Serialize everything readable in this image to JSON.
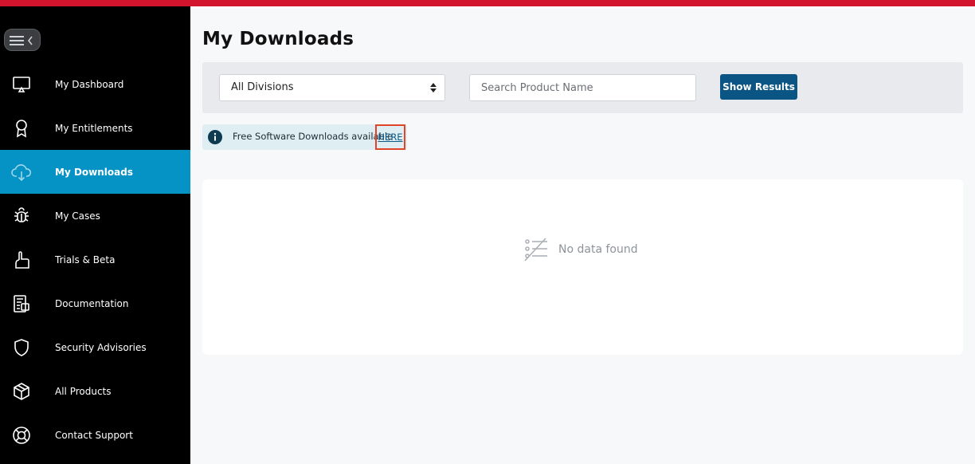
{
  "page": {
    "title": "My Downloads"
  },
  "colors": {
    "brand_red": "#d3142d",
    "active_nav": "#0592c4",
    "primary_button": "#0b5585"
  },
  "sidebar": {
    "toggle_icon": "menu-collapse-icon",
    "items": [
      {
        "label": "My Dashboard",
        "icon": "monitor-icon",
        "active": false
      },
      {
        "label": "My Entitlements",
        "icon": "award-icon",
        "active": false
      },
      {
        "label": "My Downloads",
        "icon": "cloud-download-icon",
        "active": true
      },
      {
        "label": "My Cases",
        "icon": "bug-icon",
        "active": false
      },
      {
        "label": "Trials & Beta",
        "icon": "pointer-hand-icon",
        "active": false
      },
      {
        "label": "Documentation",
        "icon": "document-icon",
        "active": false
      },
      {
        "label": "Security Advisories",
        "icon": "shield-icon",
        "active": false
      },
      {
        "label": "All Products",
        "icon": "box-icon",
        "active": false
      },
      {
        "label": "Contact Support",
        "icon": "lifebuoy-icon",
        "active": false
      }
    ]
  },
  "filters": {
    "division_selected": "All Divisions",
    "search_placeholder": "Search Product Name",
    "search_value": "",
    "button_label": "Show Results"
  },
  "notice": {
    "message": "Free Software Downloads available",
    "link_label": "HERE"
  },
  "results": {
    "empty_message": "No data found"
  }
}
